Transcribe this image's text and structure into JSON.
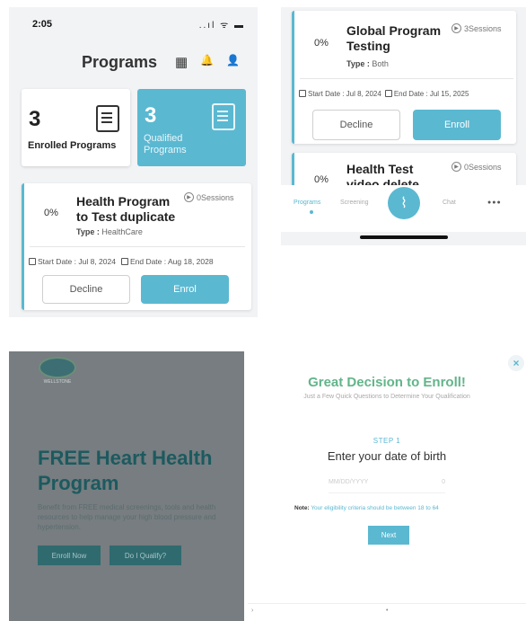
{
  "panel1": {
    "status_time": "2:05",
    "status_icons": "..ıl ᯤ ▬",
    "title": "Programs",
    "header_icons": {
      "calendar": "▦",
      "bell": "🔔",
      "profile": "👤"
    },
    "enrolled": {
      "count": "3",
      "label": "Enrolled Programs"
    },
    "qualified": {
      "count": "3",
      "label": "Qualified Programs"
    },
    "program": {
      "percent": "0%",
      "name": "Health Program to Test duplicate",
      "type_label": "Type :",
      "type_value": "HealthCare",
      "sessions": "0Sessions",
      "start_date": "Start Date : Jul 8, 2024",
      "end_date": "End Date :  Aug 18, 2028",
      "decline": "Decline",
      "enroll": "Enrol"
    }
  },
  "panel2": {
    "card1": {
      "percent": "0%",
      "name": "Global Program Testing",
      "type_label": "Type :",
      "type_value": "Both",
      "sessions": "3Sessions",
      "start_date": "Start Date : Jul 8, 2024",
      "end_date": "End Date : Jul 15, 2025",
      "decline": "Decline",
      "enroll": "Enroll"
    },
    "card2": {
      "percent": "0%",
      "name": "Health Test video delete",
      "sessions": "0Sessions"
    },
    "tabs": {
      "programs": "Programs",
      "screening": "Screening",
      "chat": "Chat",
      "more": "●●●"
    }
  },
  "panel3": {
    "logo_text": "WELLSTONE",
    "hero_title": "FREE Heart Health Program",
    "hero_body": "Benefit from FREE medical screenings, tools and health resources to help manage your high blood pressure and hypertension.",
    "enroll_button": "Enroll Now",
    "qualify_button": "Do I Qualify?"
  },
  "panel4": {
    "title": "Great Decision to Enroll!",
    "subtitle": "Just a Few Quick Questions to Determine Your Qualification",
    "step": "STEP 1",
    "question": "Enter your date of birth",
    "input_date": "MM/DD/YYYY",
    "input_age": "0",
    "note_label": "Note:",
    "note_text": "Your eligibility criteria should be between 18 to 64",
    "next": "Next"
  },
  "colors": {
    "accent": "#5bb8d1",
    "success_green": "#62b58a",
    "hero_teal": "#1c5a5f"
  }
}
